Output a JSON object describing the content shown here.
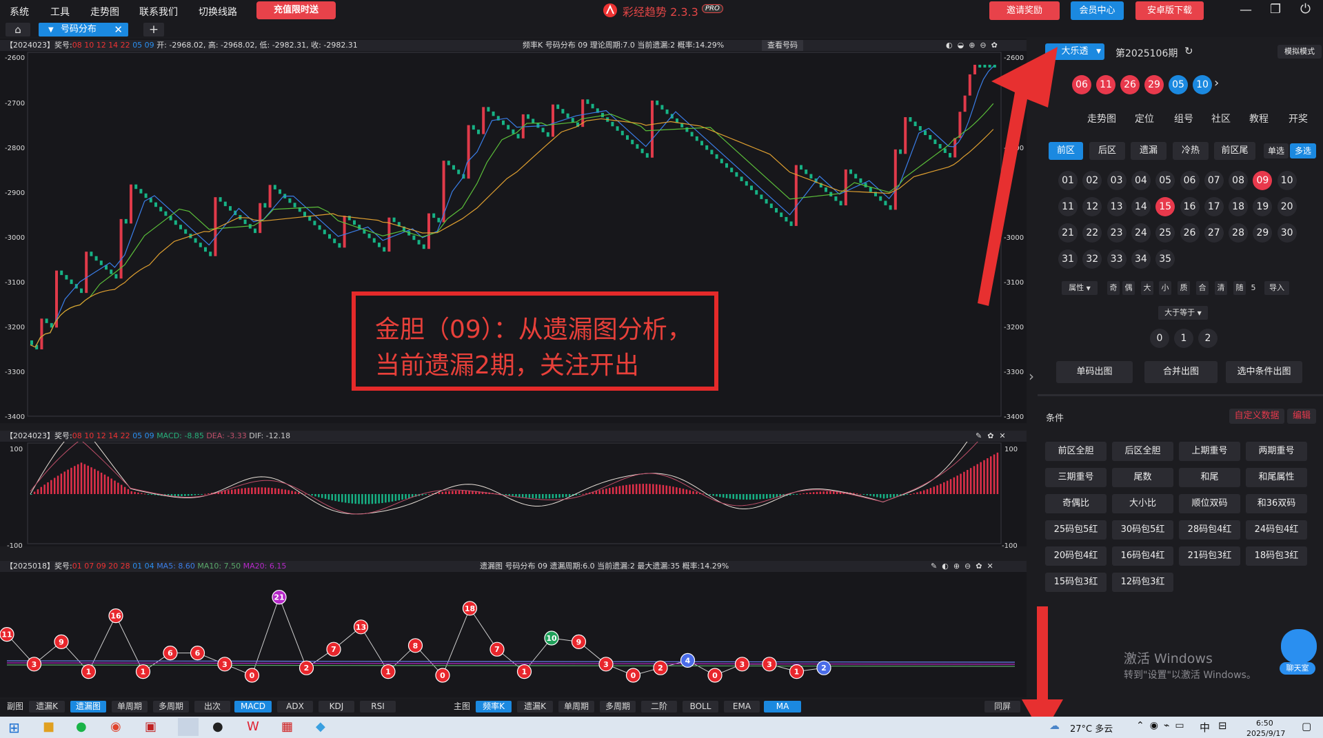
{
  "menu": [
    "系统",
    "工具",
    "走势图",
    "联系我们",
    "切换线路"
  ],
  "promo": "充值限时送",
  "app": {
    "title": "彩经趋势 2.3.3",
    "badge": "PRO"
  },
  "header_buttons": {
    "invite": "邀请奖励",
    "member": "会员中心",
    "android": "安卓版下载"
  },
  "tab": {
    "label": "号码分布"
  },
  "panel1": {
    "period": "【2024023】奖号:",
    "draw_red": "08 10 12 14 22",
    "draw_blue": "05 09",
    "ohlc": "开: -2968.02, 高: -2968.02, 低: -2982.31, 收: -2982.31",
    "info": "频率K  号码分布  09    理论周期:7.0  当前遗漏:2  概率:14.29%",
    "view": "查看号码",
    "y_ticks": [
      "-2600",
      "-2700",
      "-2800",
      "-2900",
      "-3000",
      "-3100",
      "-3200",
      "-3300",
      "-3400"
    ]
  },
  "panel2": {
    "period": "【2024023】奖号:",
    "draw_red": "08 10 12 14 22",
    "draw_blue": "05 09",
    "macd": "MACD: -8.85",
    "dea": "DEA: -3.33",
    "dif": "DIF: -12.18",
    "y_top": "100",
    "y_bottom": "-100"
  },
  "panel3": {
    "period": "【2025018】奖号:",
    "draw_red": "01 07 09 20 28",
    "draw_blue": "01 04",
    "ma5": "MA5: 8.60",
    "ma10": "MA10: 7.50",
    "ma20": "MA20: 6.15",
    "info": "遗漏图  号码分布  09    遗漏周期:6.0  当前遗漏:2  最大遗漏:35  概率:14.29%"
  },
  "annotation": [
    "金胆（09）：从遗漏图分析，",
    "当前遗漏2期，关注开出"
  ],
  "bottom_left": {
    "label": "副图",
    "items": [
      "遗漏K",
      "遗漏图",
      "单周期",
      "多周期",
      "出次",
      "MACD",
      "ADX",
      "KDJ",
      "RSI"
    ],
    "active": [
      "遗漏图",
      "MACD"
    ]
  },
  "bottom_right": {
    "label": "主图",
    "items": [
      "频率K",
      "遗漏K",
      "单周期",
      "多周期",
      "二阶",
      "BOLL",
      "EMA",
      "MA"
    ],
    "active": [
      "频率K",
      "MA"
    ]
  },
  "same_screen": "同屏",
  "right": {
    "lottery": "大乐透",
    "issue": "第2025106期",
    "sim_mode": "模拟模式",
    "last_draw_red": [
      "06",
      "11",
      "26",
      "29"
    ],
    "last_draw_blue": [
      "05",
      "10"
    ],
    "nav": [
      "走势图",
      "定位",
      "组号",
      "社区",
      "教程",
      "开奖"
    ],
    "zone_tabs": [
      "前区",
      "后区",
      "遗漏",
      "冷热",
      "前区尾"
    ],
    "single": "单选",
    "multi": "多选",
    "numbers": [
      "01",
      "02",
      "03",
      "04",
      "05",
      "06",
      "07",
      "08",
      "09",
      "10",
      "11",
      "12",
      "13",
      "14",
      "15",
      "16",
      "17",
      "18",
      "19",
      "20",
      "21",
      "22",
      "23",
      "24",
      "25",
      "26",
      "27",
      "28",
      "29",
      "30",
      "31",
      "32",
      "33",
      "34",
      "35"
    ],
    "selected": [
      "09",
      "15"
    ],
    "attr": "属性",
    "filters": [
      "奇",
      "偶",
      "大",
      "小",
      "质",
      "合",
      "清",
      "随"
    ],
    "random_count": "5",
    "import": "导入",
    "gte": "大于等于",
    "counts": [
      "0",
      "1",
      "2"
    ],
    "actions": [
      "单码出图",
      "合并出图",
      "选中条件出图"
    ],
    "conditions_title": "条件",
    "custom_data": "自定义数据",
    "edit": "编辑",
    "conditions": [
      "前区全胆",
      "后区全胆",
      "上期重号",
      "两期重号",
      "三期重号",
      "尾数",
      "和尾",
      "和尾属性",
      "奇偶比",
      "大小比",
      "顺位双码",
      "和36双码",
      "25码包5红",
      "30码包5红",
      "28码包4红",
      "24码包4红",
      "20码包4红",
      "16码包4红",
      "21码包3红",
      "18码包3红",
      "15码包3红",
      "12码包3红"
    ],
    "windows_activate": "激活 Windows",
    "windows_activate_sub": "转到\"设置\"以激活 Windows。",
    "chat": "聊天室"
  },
  "taskbar": {
    "weather": "27°C  多云",
    "time": "6:50",
    "date": "2025/9/17",
    "ime": "中"
  },
  "miss_chart": {
    "values": [
      11,
      3,
      9,
      1,
      16,
      1,
      6,
      6,
      3,
      0,
      21,
      2,
      7,
      13,
      1,
      8,
      0,
      18,
      7,
      1,
      10,
      9,
      3,
      0,
      2,
      4,
      0,
      3,
      3,
      1,
      2
    ],
    "colors": {
      "red": "#e8262c",
      "green": "#1fa05a",
      "purple": "#b629c9",
      "blue": "#4a6ce8"
    }
  }
}
